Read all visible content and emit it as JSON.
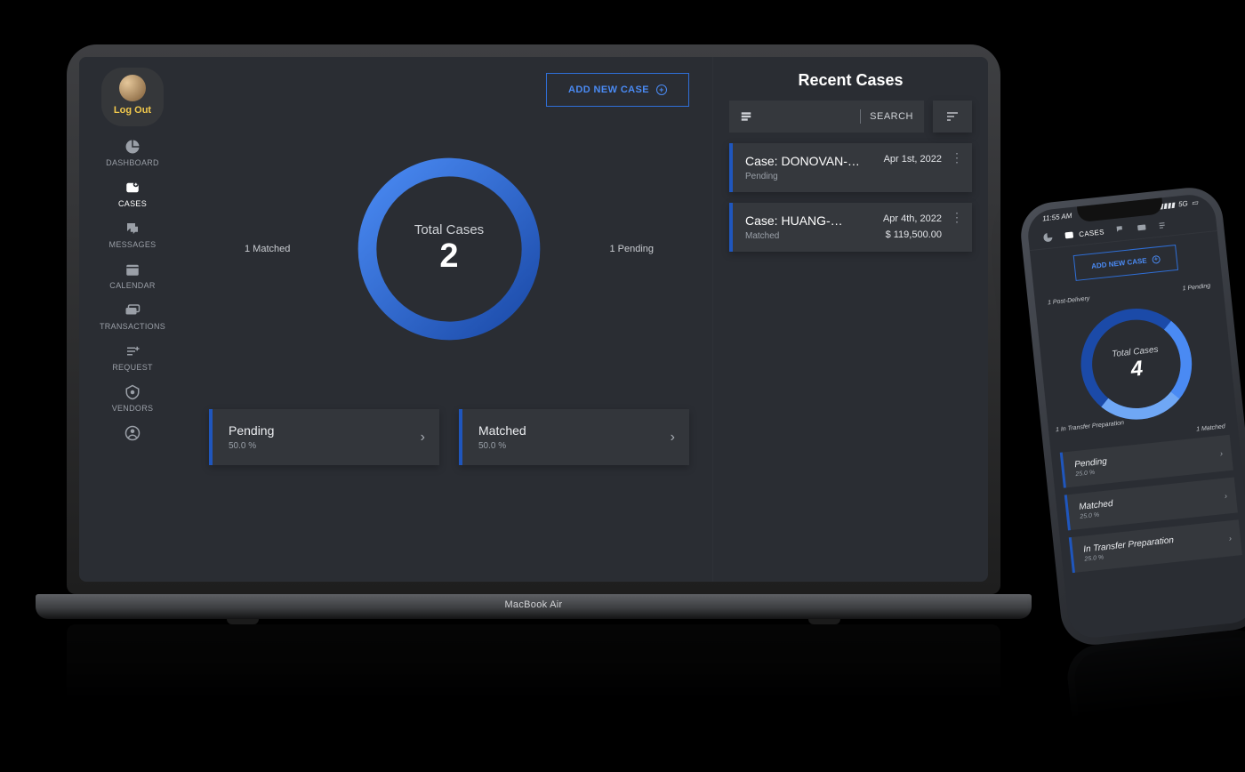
{
  "colors": {
    "accent_blue": "#2256c4",
    "ring_end": "#4a8af3",
    "yellow": "#f2c94c"
  },
  "laptop": {
    "deck_label": "MacBook Air",
    "sidebar": {
      "logout_label": "Log Out",
      "items": [
        {
          "icon": "pie-chart",
          "label": "DASHBOARD"
        },
        {
          "icon": "cases",
          "label": "CASES"
        },
        {
          "icon": "chat",
          "label": "MESSAGES"
        },
        {
          "icon": "calendar",
          "label": "CALENDAR"
        },
        {
          "icon": "transactions",
          "label": "TRANSACTIONS"
        },
        {
          "icon": "request",
          "label": "REQUEST"
        },
        {
          "icon": "vendors",
          "label": "VENDORS"
        },
        {
          "icon": "user",
          "label": ""
        }
      ],
      "active_index": 1
    },
    "add_button_label": "ADD NEW CASE",
    "chart_data": {
      "type": "pie",
      "title": "Total Cases",
      "total_value": 2,
      "series": [
        {
          "name": "Matched",
          "value": 1,
          "pct": 50.0,
          "side_label": "1 Matched"
        },
        {
          "name": "Pending",
          "value": 1,
          "pct": 50.0,
          "side_label": "1 Pending"
        }
      ]
    },
    "status_cards": [
      {
        "title": "Pending",
        "pct": "50.0 %",
        "accent": "#1f56bd"
      },
      {
        "title": "Matched",
        "pct": "50.0 %",
        "accent": "#1f56bd"
      }
    ],
    "recent": {
      "title": "Recent Cases",
      "search_label": "SEARCH",
      "cases": [
        {
          "title": "Case: DONOVAN-…",
          "status": "Pending",
          "date": "Apr 1st, 2022",
          "amount": ""
        },
        {
          "title": "Case: HUANG-…",
          "status": "Matched",
          "date": "Apr 4th, 2022",
          "amount": "$ 119,500.00"
        }
      ]
    }
  },
  "phone": {
    "status_time": "11:55 AM",
    "status_net": "5G",
    "tabs": [
      {
        "icon": "pie-chart",
        "label": ""
      },
      {
        "icon": "cases",
        "label": "CASES"
      },
      {
        "icon": "chat",
        "label": ""
      },
      {
        "icon": "card",
        "label": ""
      },
      {
        "icon": "request",
        "label": ""
      }
    ],
    "active_tab_index": 1,
    "add_button_label": "ADD NEW CASE",
    "chart_data": {
      "type": "pie",
      "title": "Total Cases",
      "total_value": 4,
      "series": [
        {
          "name": "Post-Delivery",
          "value": 1,
          "pct": 25.0,
          "side_label": "1 Post-Delivery"
        },
        {
          "name": "Pending",
          "value": 1,
          "pct": 25.0,
          "side_label": "1 Pending"
        },
        {
          "name": "Matched",
          "value": 1,
          "pct": 25.0,
          "side_label": "1 Matched"
        },
        {
          "name": "In Transfer Preparation",
          "value": 1,
          "pct": 25.0,
          "side_label": "1 In Transfer Preparation"
        }
      ]
    },
    "status_cards": [
      {
        "title": "Pending",
        "pct": "25.0 %"
      },
      {
        "title": "Matched",
        "pct": "25.0 %"
      },
      {
        "title": "In Transfer Preparation",
        "pct": "25.0 %"
      }
    ]
  }
}
